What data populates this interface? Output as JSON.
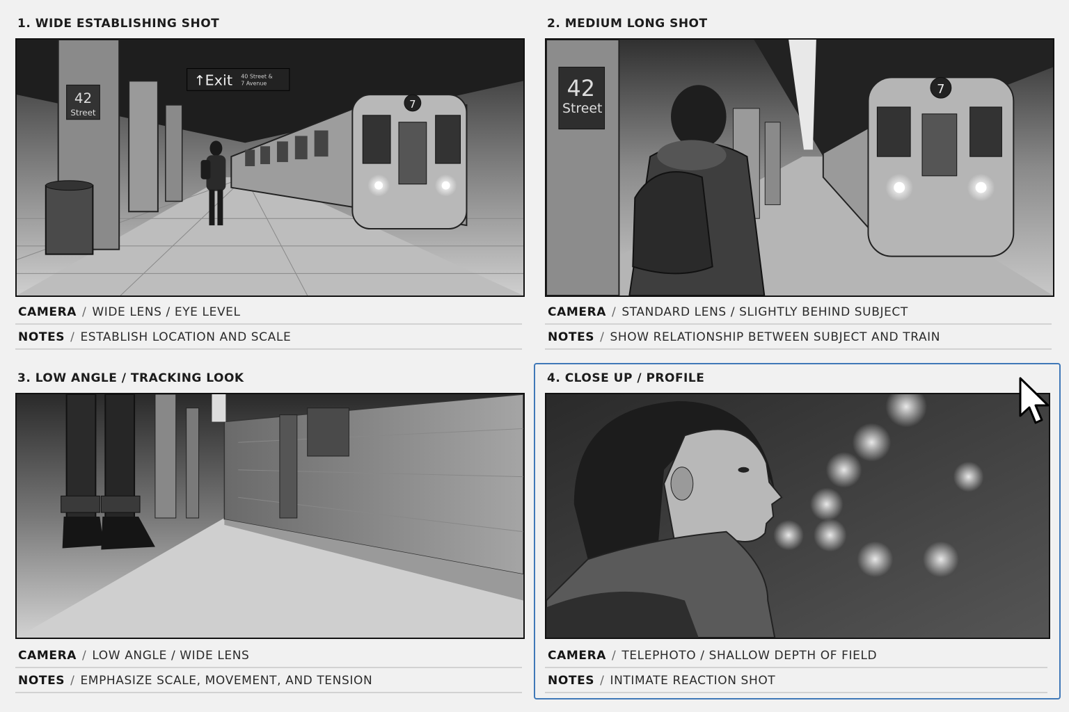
{
  "panels": [
    {
      "title": "1. WIDE ESTABLISHING SHOT",
      "camera_label": "CAMERA",
      "camera": "WIDE LENS / EYE LEVEL",
      "notes_label": "NOTES",
      "notes": "ESTABLISH LOCATION AND SCALE",
      "image_text": {
        "station_number": "42",
        "station_name": "Street",
        "exit_sign": "Exit",
        "exit_sub_1": "40 Street &",
        "exit_sub_2": "7 Avenue",
        "train_line": "7"
      },
      "selected": false
    },
    {
      "title": "2. MEDIUM LONG SHOT",
      "camera_label": "CAMERA",
      "camera": "STANDARD LENS / SLIGHTLY BEHIND SUBJECT",
      "notes_label": "NOTES",
      "notes": "SHOW RELATIONSHIP BETWEEN SUBJECT AND TRAIN",
      "image_text": {
        "station_number": "42",
        "station_name": "Street",
        "train_line": "7"
      },
      "selected": false
    },
    {
      "title": "3. LOW ANGLE / TRACKING LOOK",
      "camera_label": "CAMERA",
      "camera": "LOW ANGLE / WIDE LENS",
      "notes_label": "NOTES",
      "notes": "EMPHASIZE SCALE, MOVEMENT, AND TENSION",
      "selected": false
    },
    {
      "title": "4. CLOSE UP / PROFILE",
      "camera_label": "CAMERA",
      "camera": "TELEPHOTO / SHALLOW DEPTH OF FIELD",
      "notes_label": "NOTES",
      "notes": "INTIMATE REACTION SHOT",
      "selected": true
    }
  ],
  "separator": "/",
  "colors": {
    "background": "#f1f1f1",
    "selection_border": "#3f78b8",
    "frame_border": "#111111"
  },
  "cursor": {
    "icon": "arrow-cursor-icon"
  }
}
